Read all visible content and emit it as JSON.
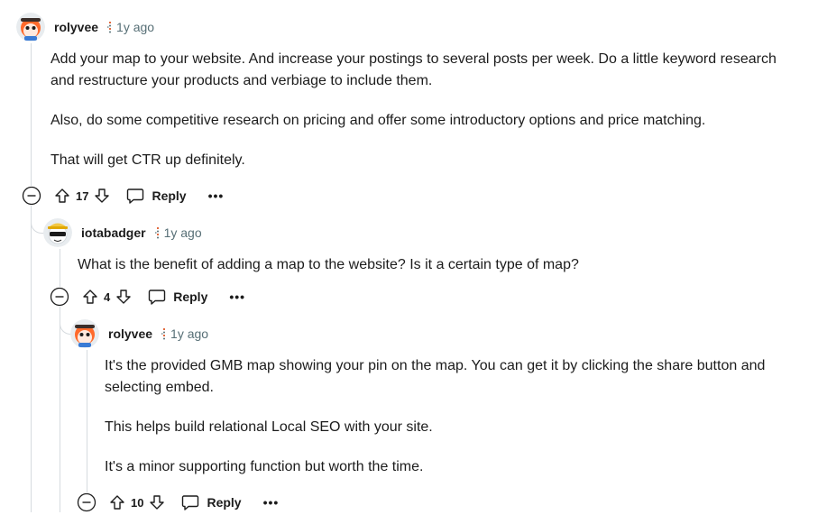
{
  "comments": [
    {
      "username": "rolyvee",
      "timestamp": "1y ago",
      "paragraphs": [
        "Add your map to your website. And increase your postings to several posts per week. Do a little keyword research and restructure your products and verbiage to include them.",
        "Also, do some competitive research on pricing and offer some introductory options and price matching.",
        "That will get CTR up definitely."
      ],
      "votes": "17",
      "reply_label": "Reply",
      "more_label": "•••"
    },
    {
      "username": "iotabadger",
      "timestamp": "1y ago",
      "paragraphs": [
        "What is the benefit of adding a map to the website? Is it a certain type of map?"
      ],
      "votes": "4",
      "reply_label": "Reply",
      "more_label": "•••"
    },
    {
      "username": "rolyvee",
      "timestamp": "1y ago",
      "paragraphs": [
        "It's the provided GMB map showing your pin on the map. You can get it by clicking the share button and selecting embed.",
        "This helps build relational Local SEO with your site.",
        "It's a minor supporting function but worth the time."
      ],
      "votes": "10",
      "reply_label": "Reply",
      "more_label": "•••"
    }
  ],
  "colors": {
    "thread_line": "#d6dbdf",
    "text": "#1c1c1c",
    "meta": "#576f76",
    "op_flair_red": "#d93a00"
  },
  "icons": [
    "avatar-rolyvee-icon",
    "avatar-iotabadger-icon",
    "upvote-icon",
    "downvote-icon",
    "reply-icon",
    "collapse-icon"
  ]
}
